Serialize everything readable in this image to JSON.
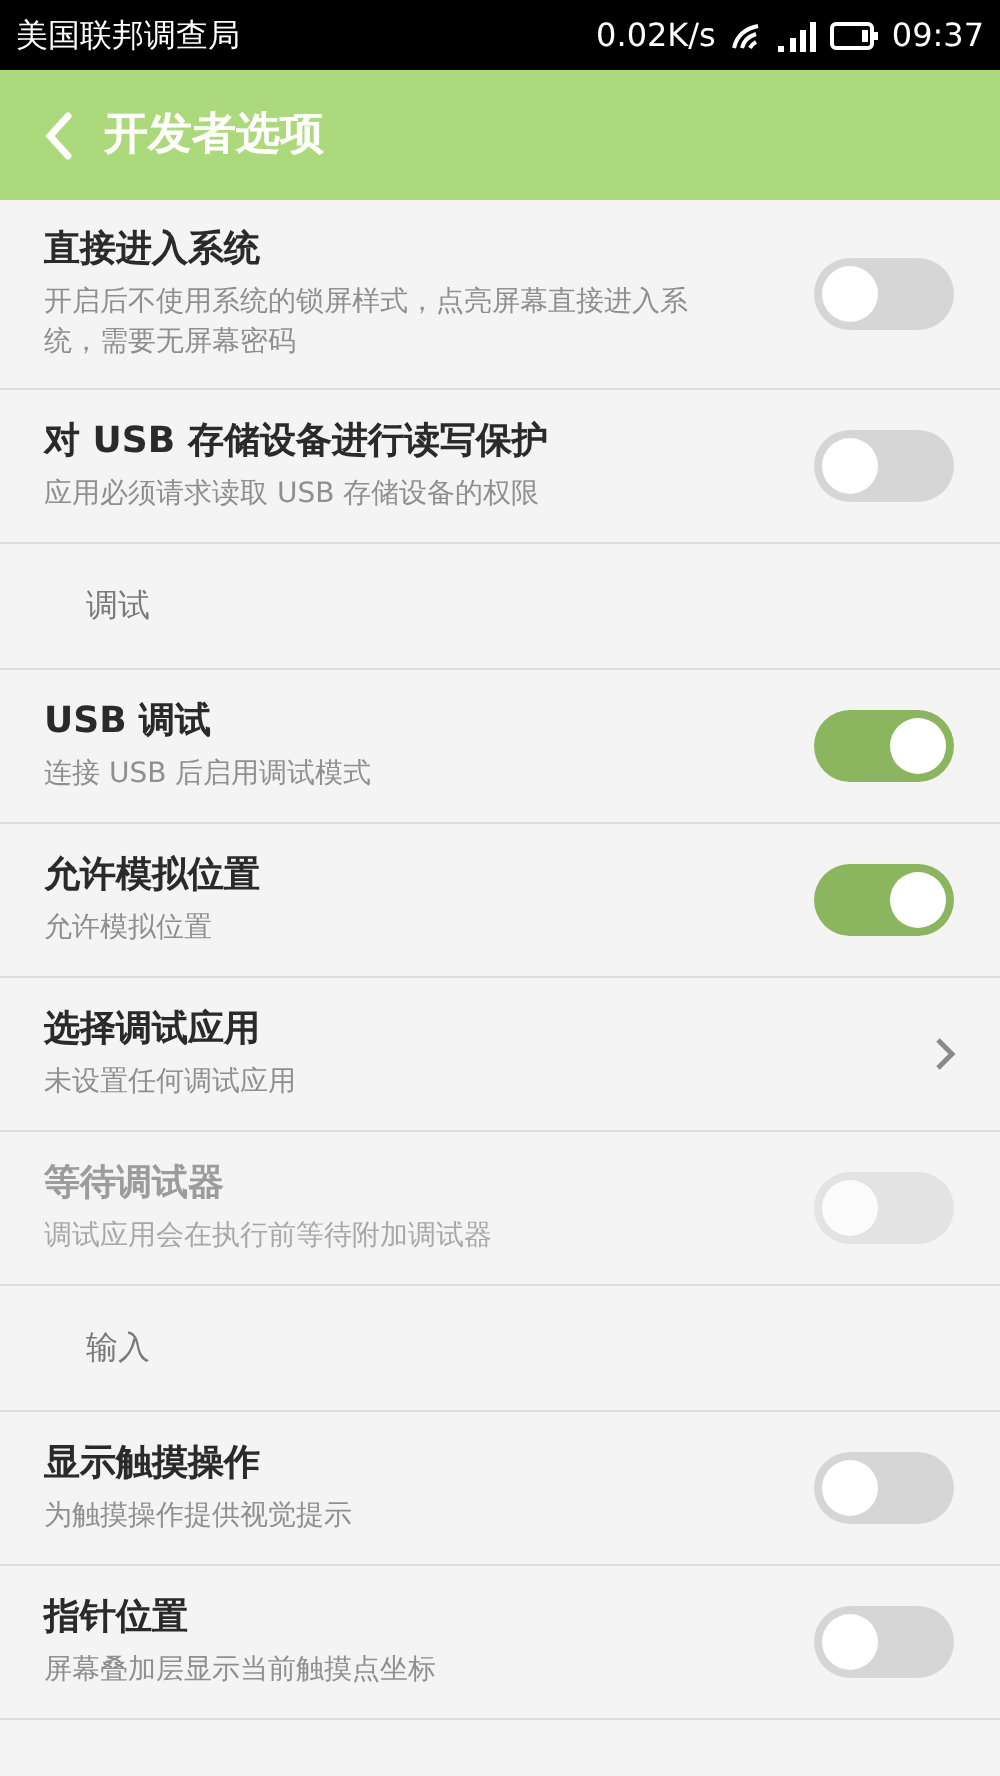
{
  "status_bar": {
    "carrier": "美国联邦调查局",
    "speed": "0.02K/s",
    "time": "09:37"
  },
  "header": {
    "title": "开发者选项"
  },
  "sections": [
    {
      "items": [
        {
          "kind": "toggle",
          "title": "直接进入系统",
          "subtitle": "开启后不使用系统的锁屏样式，点亮屏幕直接进入系统，需要无屏幕密码",
          "on": false,
          "disabled": false
        },
        {
          "kind": "toggle",
          "title": "对 USB 存储设备进行读写保护",
          "subtitle": "应用必须请求读取 USB 存储设备的权限",
          "on": false,
          "disabled": false
        }
      ]
    },
    {
      "heading": "调试",
      "items": [
        {
          "kind": "toggle",
          "title": "USB 调试",
          "subtitle": "连接 USB 后启用调试模式",
          "on": true,
          "disabled": false
        },
        {
          "kind": "toggle",
          "title": "允许模拟位置",
          "subtitle": "允许模拟位置",
          "on": true,
          "disabled": false
        },
        {
          "kind": "link",
          "title": "选择调试应用",
          "subtitle": "未设置任何调试应用",
          "disabled": false
        },
        {
          "kind": "toggle",
          "title": "等待调试器",
          "subtitle": "调试应用会在执行前等待附加调试器",
          "on": false,
          "disabled": true
        }
      ]
    },
    {
      "heading": "输入",
      "items": [
        {
          "kind": "toggle",
          "title": "显示触摸操作",
          "subtitle": "为触摸操作提供视觉提示",
          "on": false,
          "disabled": false
        },
        {
          "kind": "toggle",
          "title": "指针位置",
          "subtitle": "屏幕叠加层显示当前触摸点坐标",
          "on": false,
          "disabled": false
        }
      ]
    }
  ]
}
